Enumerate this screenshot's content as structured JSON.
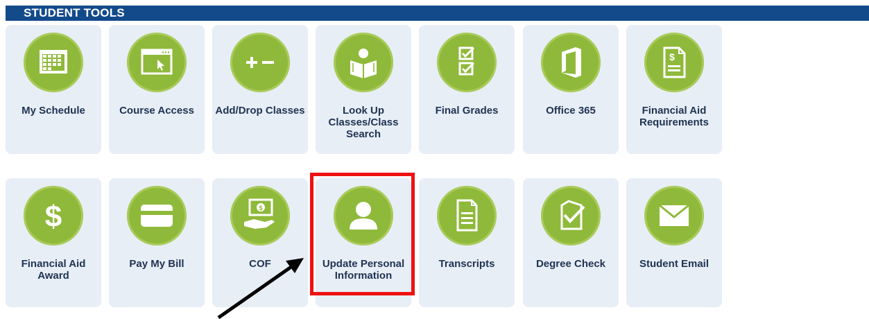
{
  "header": {
    "title": "STUDENT TOOLS"
  },
  "tiles": [
    {
      "label": "My Schedule",
      "icon": "calendar-icon"
    },
    {
      "label": "Course Access",
      "icon": "browser-window-icon"
    },
    {
      "label": "Add/Drop Classes",
      "icon": "plus-minus-icon"
    },
    {
      "label": "Look Up Classes/Class Search",
      "icon": "open-book-icon"
    },
    {
      "label": "Final Grades",
      "icon": "checklist-icon"
    },
    {
      "label": "Office 365",
      "icon": "office-logo-icon"
    },
    {
      "label": "Financial Aid Requirements",
      "icon": "dollar-document-icon"
    },
    {
      "label": "Financial Aid Award",
      "icon": "dollar-icon"
    },
    {
      "label": "Pay My Bill",
      "icon": "credit-card-icon"
    },
    {
      "label": "COF",
      "icon": "cash-in-hand-icon"
    },
    {
      "label": "Update Personal Information",
      "icon": "user-icon"
    },
    {
      "label": "Transcripts",
      "icon": "document-icon"
    },
    {
      "label": "Degree Check",
      "icon": "document-check-icon"
    },
    {
      "label": "Student Email",
      "icon": "envelope-icon"
    }
  ],
  "colors": {
    "header_bg": "#134a8a",
    "tile_bg": "#e8eef6",
    "icon_circle": "#8fb93a",
    "label_text": "#1e3352",
    "highlight": "#ee1111"
  }
}
